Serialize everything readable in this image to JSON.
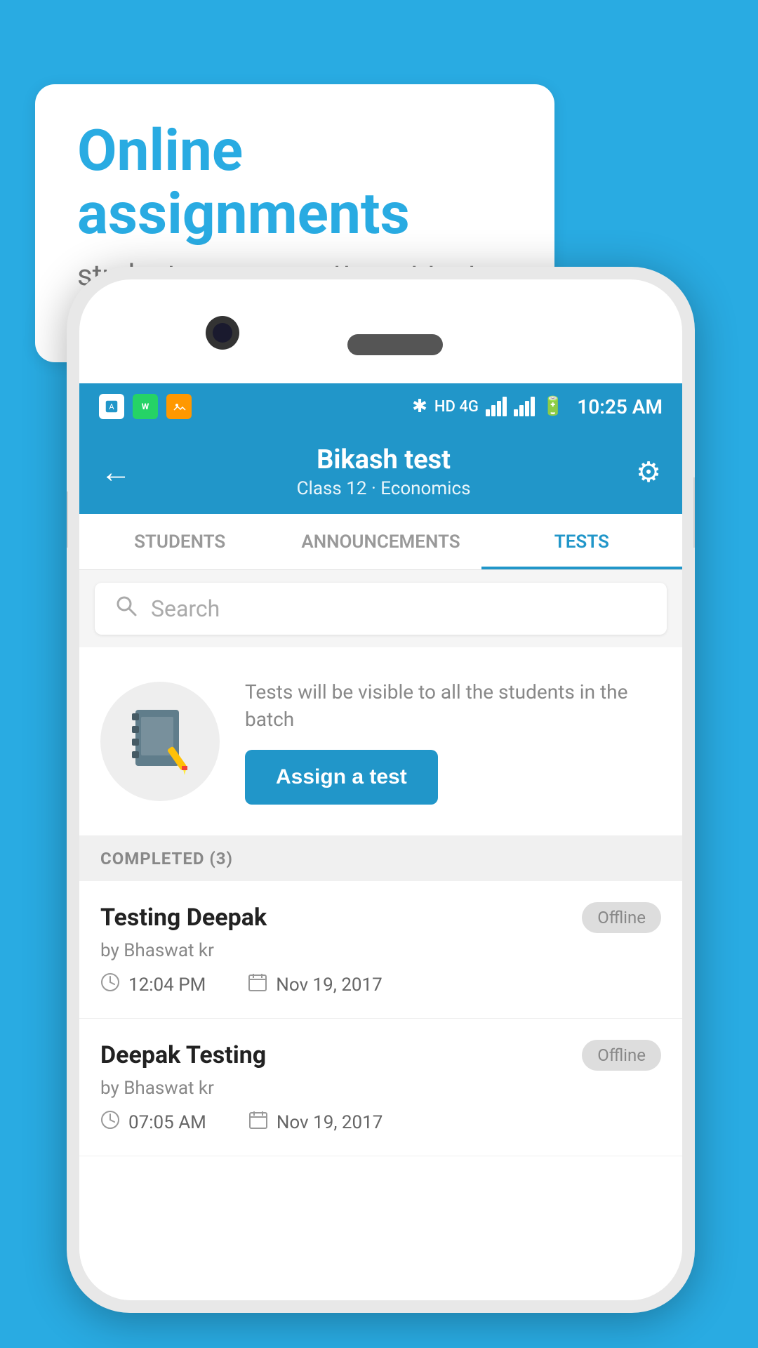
{
  "background_color": "#29ABE2",
  "bubble": {
    "title": "Online assignments",
    "subtitle": "students can now attempt tests online"
  },
  "status_bar": {
    "time": "10:25 AM",
    "network": "HD 4G",
    "icons": [
      "☰",
      "◎",
      "⬛"
    ]
  },
  "app_bar": {
    "back_icon": "←",
    "title": "Bikash test",
    "subtitle": "Class 12 · Economics",
    "settings_icon": "⚙"
  },
  "tabs": [
    {
      "label": "STUDENTS",
      "active": false
    },
    {
      "label": "ANNOUNCEMENTS",
      "active": false
    },
    {
      "label": "TESTS",
      "active": true
    }
  ],
  "search": {
    "placeholder": "Search"
  },
  "assign": {
    "description": "Tests will be visible to all the students in the batch",
    "button_label": "Assign a test"
  },
  "completed_section": {
    "label": "COMPLETED (3)"
  },
  "tests": [
    {
      "name": "Testing Deepak",
      "by": "by Bhaswat kr",
      "time": "12:04 PM",
      "date": "Nov 19, 2017",
      "badge": "Offline"
    },
    {
      "name": "Deepak Testing",
      "by": "by Bhaswat kr",
      "time": "07:05 AM",
      "date": "Nov 19, 2017",
      "badge": "Offline"
    }
  ]
}
